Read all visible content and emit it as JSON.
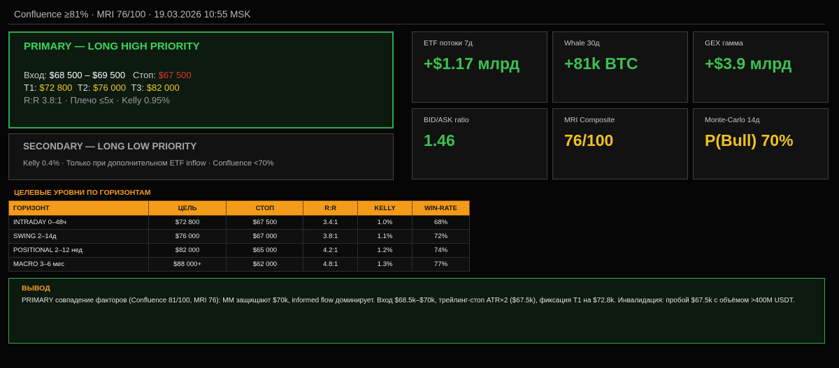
{
  "header": {
    "text": "Confluence ≥81% · MRI 76/100 · 19.03.2026 10:55 MSK"
  },
  "primary": {
    "title": "PRIMARY — LONG HIGH PRIORITY",
    "entry_label": "Вход:",
    "entry_value": "$68 500 – $69 500",
    "stop_label": "Стоп:",
    "stop_value": "$67 500",
    "t1_label": "T1:",
    "t1_value": "$72 800",
    "t2_label": "T2:",
    "t2_value": "$76 000",
    "t3_label": "T3:",
    "t3_value": "$82 000",
    "meta": "R:R 3.8:1  ·  Плечо ≤5x  ·  Kelly 0.95%"
  },
  "secondary": {
    "title": "SECONDARY — LONG LOW PRIORITY",
    "subtitle": "Kelly 0.4% · Только при дополнительном ETF inflow · Confluence <70%"
  },
  "metrics": [
    {
      "label": "ETF потоки 7д",
      "value": "+$1.17 млрд",
      "color": "#3ec04f"
    },
    {
      "label": "Whale 30д",
      "value": "+81k BTC",
      "color": "#3ec04f"
    },
    {
      "label": "GEX гамма",
      "value": "+$3.9 млрд",
      "color": "#3ec04f"
    },
    {
      "label": "BID/ASK ratio",
      "value": "1.46",
      "color": "#3ec04f"
    },
    {
      "label": "MRI Composite",
      "value": "76/100",
      "color": "#f0c21f"
    },
    {
      "label": "Monte-Carlo 14д",
      "value": "P(Bull) 70%",
      "color": "#f0c21f"
    }
  ],
  "levels": {
    "title": "ЦЕЛЕВЫЕ УРОВНИ ПО ГОРИЗОНТАМ",
    "columns": [
      "ГОРИЗОНТ",
      "ЦЕЛЬ",
      "СТОП",
      "R:R",
      "KELLY",
      "WIN-RATE"
    ],
    "rows": [
      [
        "INTRADAY 0–48ч",
        "$72 800",
        "$67 500",
        "3.4:1",
        "1.0%",
        "68%"
      ],
      [
        "SWING 2–14д",
        "$76 000",
        "$67 000",
        "3.8:1",
        "1.1%",
        "72%"
      ],
      [
        "POSITIONAL 2–12 нед",
        "$82 000",
        "$65 000",
        "4.2:1",
        "1.2%",
        "74%"
      ],
      [
        "MACRO 3–6 мес",
        "$88 000+",
        "$62 000",
        "4.8:1",
        "1.3%",
        "77%"
      ]
    ]
  },
  "verdict": {
    "title": "ВЫВОД",
    "text": "PRIMARY совпадение факторов (Confluence 81/100, MRI 76): MM защищают $70k, informed flow доминирует. Вход $68.5k–$70k, трейлинг-стоп ATR×2 ($67.5k), фиксация T1 на $72.8k. Инвалидация: пробой $67.5k с объёмом >400M USDT."
  }
}
